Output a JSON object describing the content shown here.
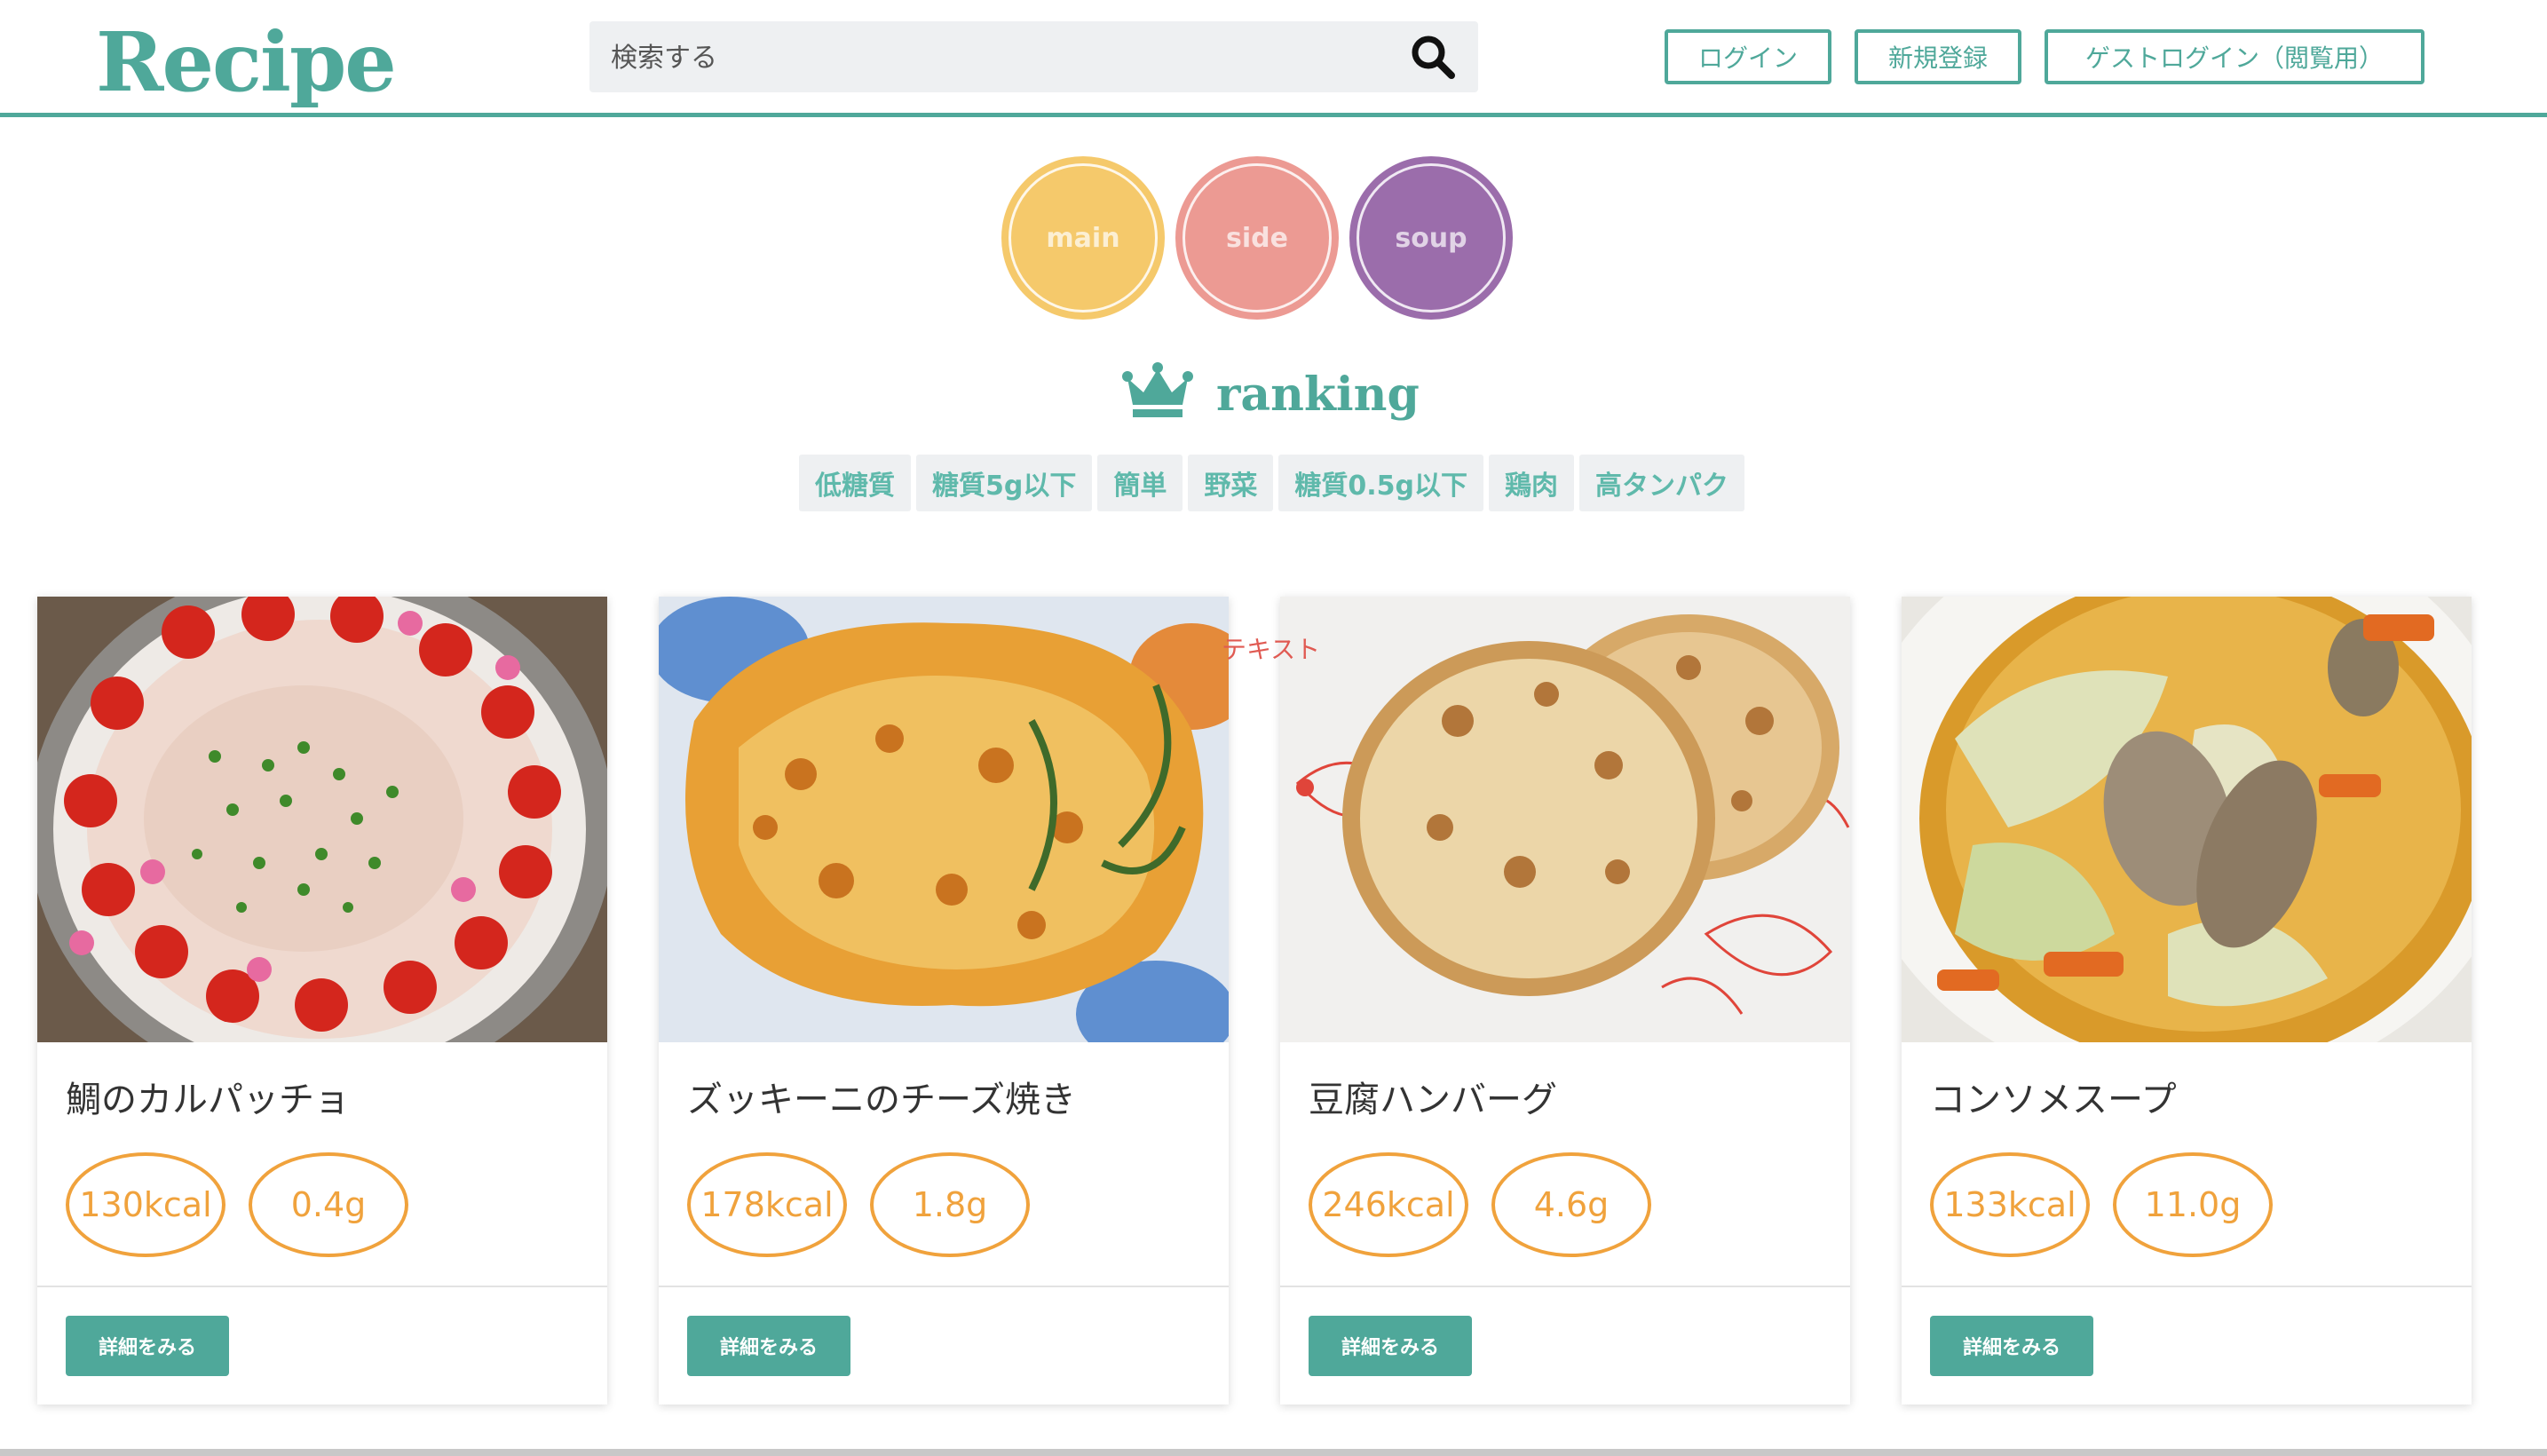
{
  "header": {
    "logo": "Recipe",
    "search_placeholder": "検索する",
    "login_label": "ログイン",
    "signup_label": "新規登録",
    "guest_login_label": "ゲストログイン（閲覧用）",
    "search_icon": "search-icon"
  },
  "categories": [
    {
      "label": "main",
      "color": "#f5c96b"
    },
    {
      "label": "side",
      "color": "#ec9a93"
    },
    {
      "label": "soup",
      "color": "#9b6dab"
    }
  ],
  "ranking": {
    "title": "ranking",
    "icon": "crown-icon",
    "tags": [
      "低糖質",
      "糖質5g以下",
      "簡単",
      "野菜",
      "糖質0.5g以下",
      "鶏肉",
      "高タンパク"
    ]
  },
  "floating_text": "テキスト",
  "recipes": [
    {
      "name": "鯛のカルパッチョ",
      "calories": "130kcal",
      "carbs": "0.4g",
      "detail_label": "詳細をみる"
    },
    {
      "name": "ズッキーニのチーズ焼き",
      "calories": "178kcal",
      "carbs": "1.8g",
      "detail_label": "詳細をみる"
    },
    {
      "name": "豆腐ハンバーグ",
      "calories": "246kcal",
      "carbs": "4.6g",
      "detail_label": "詳細をみる"
    },
    {
      "name": "コンソメスープ",
      "calories": "133kcal",
      "carbs": "11.0g",
      "detail_label": "詳細をみる"
    }
  ],
  "colors": {
    "brand": "#4fa89a",
    "accent": "#f0a23c",
    "tag_text": "#5fb9ab"
  }
}
